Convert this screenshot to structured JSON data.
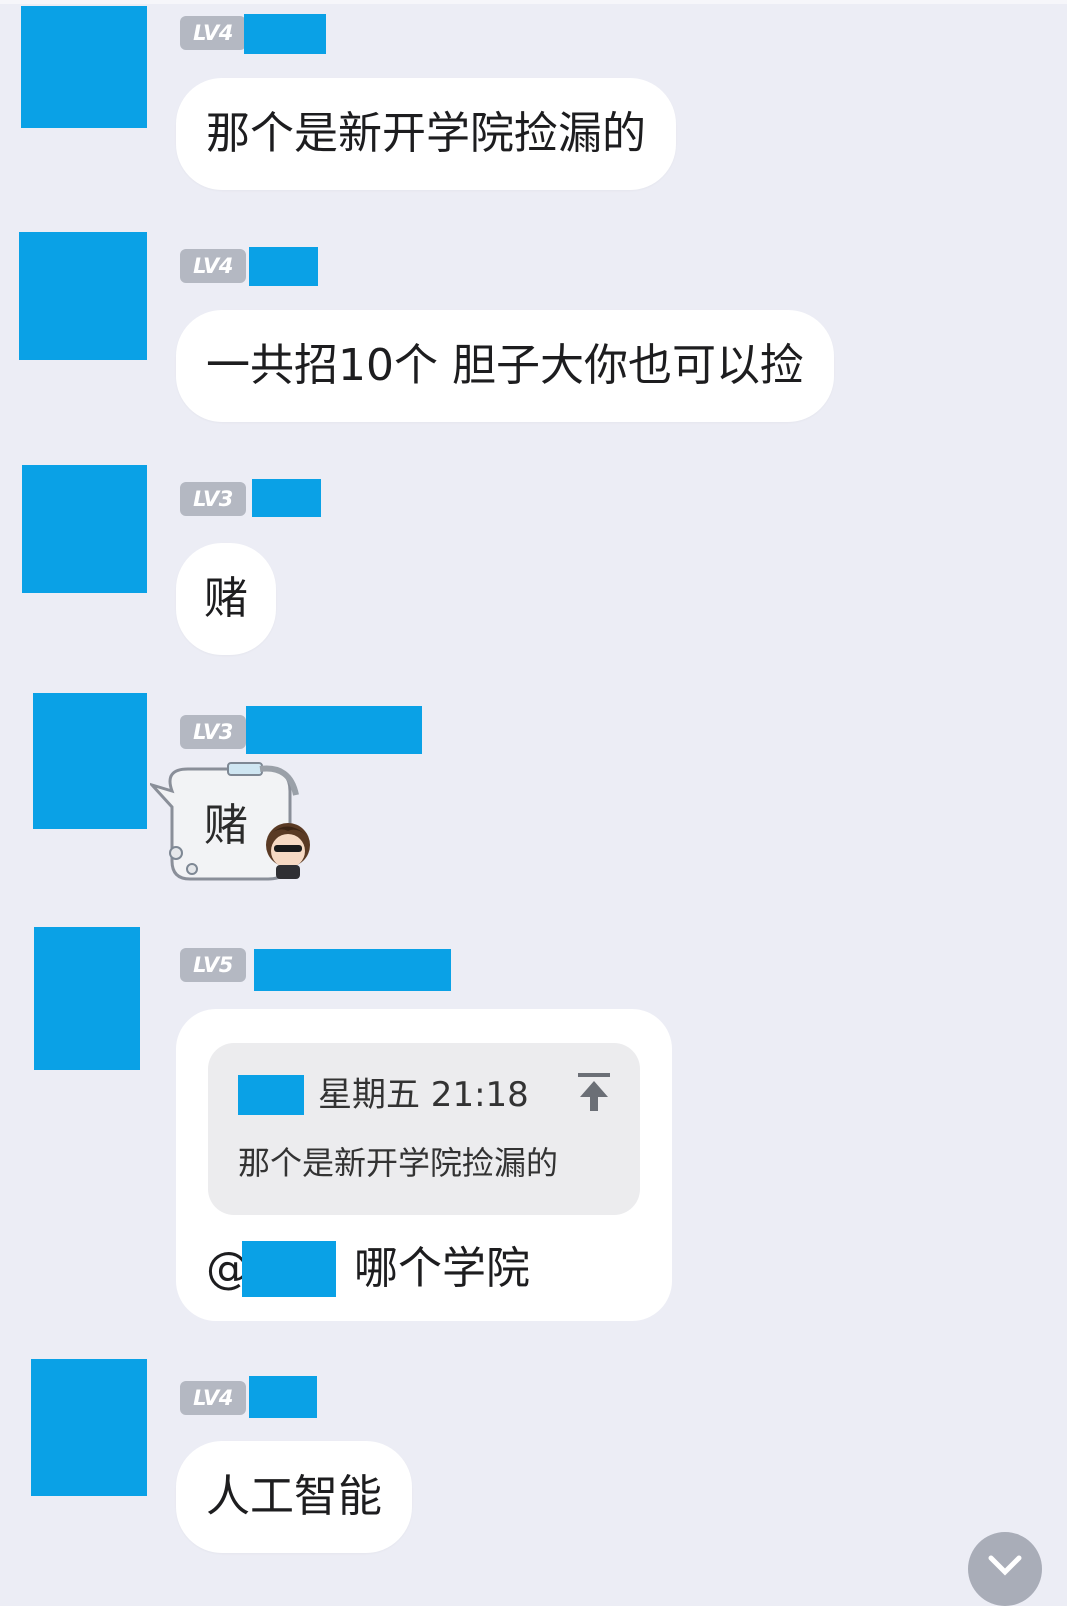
{
  "messages": [
    {
      "level": "LV4",
      "text": "那个是新开学院捡漏的"
    },
    {
      "level": "LV4",
      "text": "一共招10个 胆子大你也可以捡"
    },
    {
      "level": "LV3",
      "text": "赌"
    },
    {
      "level": "LV3",
      "sticker_text": "赌"
    },
    {
      "level": "LV5",
      "quote": {
        "time": "星期五 21:18",
        "text": "那个是新开学院捡漏的"
      },
      "mention_prefix": "@",
      "text": "哪个学院"
    },
    {
      "level": "LV4",
      "text": "人工智能"
    }
  ],
  "icons": {
    "quote_jump": "arrow-up-to-top-icon",
    "scroll_down": "chevron-down-icon"
  },
  "colors": {
    "redaction": "#0aa1e6",
    "background": "#ecedf5",
    "bubble": "#ffffff",
    "level_badge": "#b4b8c2"
  }
}
